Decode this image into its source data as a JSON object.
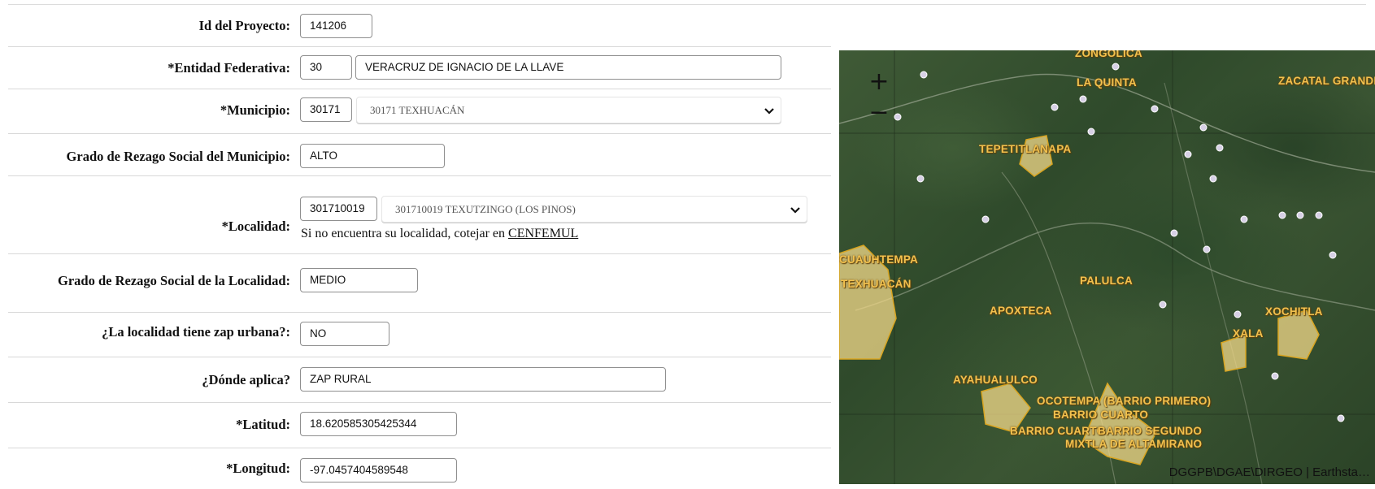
{
  "form": {
    "project_id": {
      "label": "Id del Proyecto:",
      "value": "141206"
    },
    "state": {
      "label": "*Entidad Federativa:",
      "code": "30",
      "name": "VERACRUZ DE IGNACIO DE LA LLAVE"
    },
    "municipality": {
      "label": "*Municipio:",
      "code": "30171",
      "selected": "30171 TEXHUACÁN"
    },
    "municipality_lag": {
      "label": "Grado de Rezago Social del Municipio:",
      "value": "ALTO"
    },
    "locality": {
      "label": "*Localidad:",
      "code": "301710019",
      "selected": "301710019 TEXUTZINGO (LOS PINOS)",
      "note": "Si no encuentra su localidad, cotejar en",
      "link": "CENFEMUL"
    },
    "locality_lag": {
      "label": "Grado de Rezago Social de la Localidad:",
      "value": "MEDIO"
    },
    "urban_zap": {
      "label": "¿La localidad tiene zap urbana?:",
      "value": "NO"
    },
    "applies": {
      "label": "¿Dónde aplica?",
      "value": "ZAP RURAL"
    },
    "latitude": {
      "label": "*Latitud:",
      "value": "18.620585305425344"
    },
    "longitude": {
      "label": "*Longitud:",
      "value": "-97.0457404589548"
    }
  },
  "map": {
    "zoom_in": "+",
    "zoom_out": "−",
    "places": [
      "ZONGOLICA",
      "LA QUINTA",
      "ZACATAL GRANDE",
      "TEPETITLANAPA",
      "CUAUHTEMPA",
      "TEXHUACÁN",
      "PALULCA",
      "APOXTECA",
      "XOCHITLA",
      "XALA",
      "AYAHUALULCO",
      "OCOTEMPA (BARRIO PRIMERO)",
      "BARRIO CUARTO",
      "BARRIO CUARTO",
      "BARRIO SEGUNDO",
      "MIXTLA DE ALTAMIRANO"
    ],
    "attribution": "DGGPB\\DGAE\\DIRGEO | Earthsta…",
    "colors": {
      "place_label": "#f2c14e",
      "settlement_fill": "#f3d98a",
      "settlement_stroke": "#d9a520"
    }
  }
}
